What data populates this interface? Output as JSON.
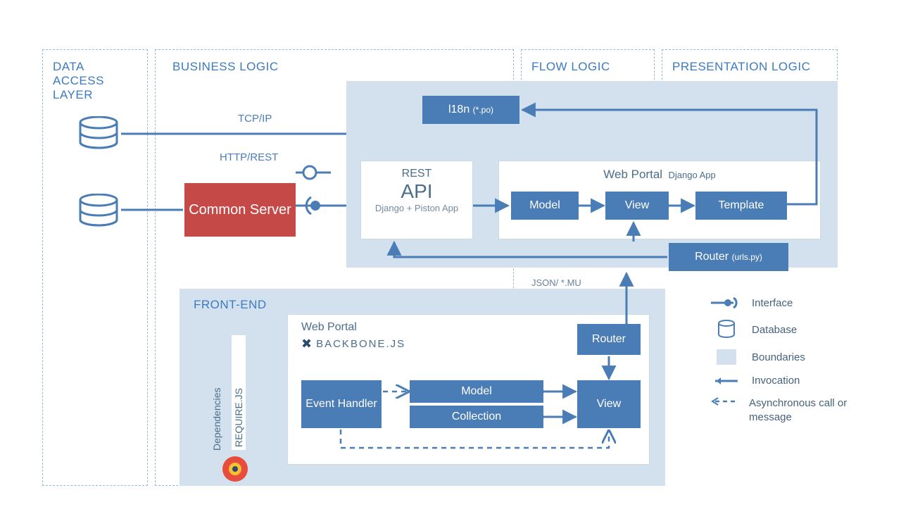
{
  "layers": {
    "data_access": "DATA ACCESS LAYER",
    "business": "BUSINESS LOGIC",
    "flow": "FLOW LOGIC",
    "presentation": "PRESENTATION LOGIC",
    "frontend": "FRONT-END"
  },
  "blocks": {
    "i18n": "l18n",
    "i18n_sub": "(*.po)",
    "common_server": "Common Server",
    "model": "Model",
    "view": "View",
    "template": "Template",
    "router": "Router",
    "router_sub": "(urls.py)",
    "event_handler": "Event Handler",
    "fe_model": "Model",
    "fe_collection": "Collection",
    "fe_view": "View",
    "fe_router": "Router"
  },
  "panels": {
    "web_portal": "Web Portal",
    "web_portal_sub": "Django App",
    "fe_web_portal": "Web Portal",
    "backbone": "BACKBONE.JS"
  },
  "api": {
    "rest": "REST",
    "api": "API",
    "sub": "Django + Piston App"
  },
  "labels": {
    "tcpip": "TCP/IP",
    "httprest": "HTTP/REST",
    "json": "JSON/ *.MU",
    "deps": "Dependencies",
    "require": "REQUIRE.JS"
  },
  "legend": {
    "interface": "Interface",
    "database": "Database",
    "boundaries": "Boundaries",
    "invocation": "Invocation",
    "async": "Asynchronous call or message"
  }
}
